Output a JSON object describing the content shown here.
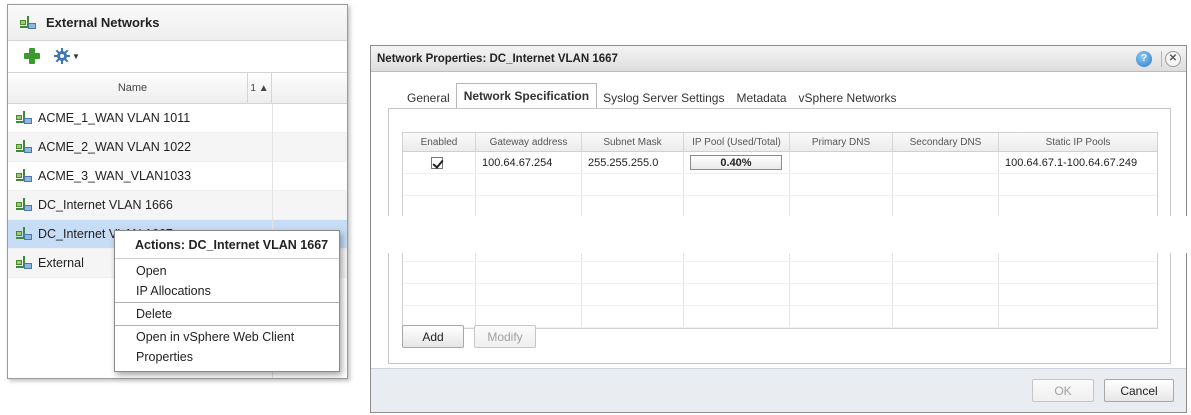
{
  "left_panel": {
    "title": "External Networks",
    "toolbar": {
      "add_icon": "plus-icon",
      "actions_icon": "gear-icon"
    },
    "columns": {
      "name": "Name",
      "sort": "1 ▲"
    },
    "rows": [
      {
        "label": "ACME_1_WAN VLAN 1011"
      },
      {
        "label": "ACME_2_WAN VLAN 1022"
      },
      {
        "label": "ACME_3_WAN_VLAN1033"
      },
      {
        "label": "DC_Internet VLAN 1666"
      },
      {
        "label": "DC_Internet VLAN 1667"
      },
      {
        "label": "External"
      }
    ],
    "selected_row": "DC_Internet VLAN 1667"
  },
  "context_menu": {
    "title": "Actions: DC_Internet VLAN 1667",
    "items": [
      "Open",
      "IP Allocations",
      "Delete",
      "Open in vSphere Web Client",
      "Properties"
    ]
  },
  "dialog": {
    "title": "Network Properties: DC_Internet VLAN 1667",
    "help_glyph": "?",
    "close_glyph": "✕",
    "tabs": [
      "General",
      "Network Specification",
      "Syslog Server Settings",
      "Metadata",
      "vSphere Networks"
    ],
    "active_tab": "Network Specification",
    "grid": {
      "headers": [
        "Enabled",
        "Gateway address",
        "Subnet Mask",
        "IP Pool (Used/Total)",
        "Primary DNS",
        "Secondary DNS",
        "Static IP Pools"
      ],
      "rows": [
        {
          "enabled": true,
          "gateway": "100.64.67.254",
          "subnet": "255.255.255.0",
          "ip_pool": "0.40%",
          "primary_dns": "",
          "secondary_dns": "",
          "static_pools": "100.64.67.1-100.64.67.249"
        }
      ]
    },
    "buttons": {
      "add": "Add",
      "modify": "Modify",
      "ok": "OK",
      "cancel": "Cancel"
    }
  },
  "colors": {
    "selection": "#c7dcf5",
    "footer": "#e9edf2",
    "network_icon_green": "#3a8a3a"
  }
}
